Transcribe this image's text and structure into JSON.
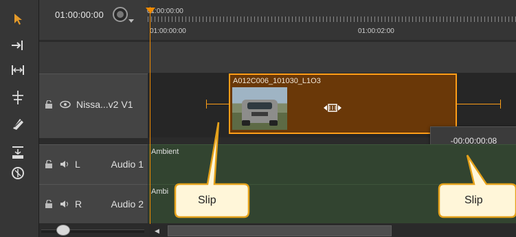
{
  "timeline": {
    "timecode": "01:00:00:00",
    "ruler": {
      "playhead_label": "01:00:00:00",
      "start_label": "01:00:00:00",
      "mid_label": "01:00:02:00"
    }
  },
  "tracks": {
    "video": {
      "name": "Nissa...v2 V1"
    },
    "audio1": {
      "channel": "L",
      "name": "Audio 1",
      "clip_name": "Ambient"
    },
    "audio2": {
      "channel": "R",
      "name": "Audio 2",
      "clip_name": "Ambi"
    }
  },
  "clip": {
    "name": "A012C006_101030_L1O3",
    "border_color": "#ff9e18",
    "fill_color": "#6a3808"
  },
  "tooltip": {
    "offset": "-00:00:00:08"
  },
  "callouts": [
    {
      "label": "Slip"
    },
    {
      "label": "Slip"
    }
  ],
  "colors": {
    "playhead": "#f08a00",
    "audio_track": "#324430"
  },
  "icons": [
    "pointer-icon",
    "ripple-icon",
    "stretch-icon",
    "razor-icon",
    "slip-icon",
    "insert-icon",
    "zoom-icon",
    "lock-icon",
    "eye-icon",
    "speaker-icon"
  ]
}
